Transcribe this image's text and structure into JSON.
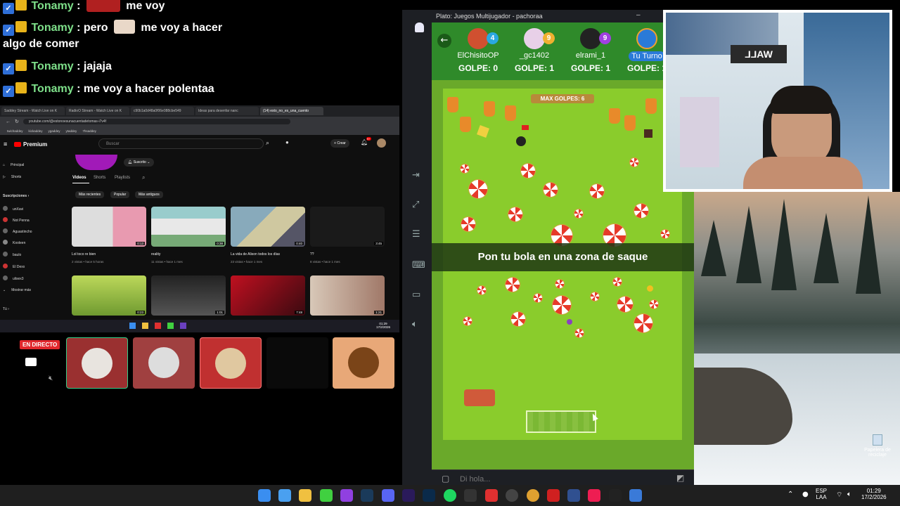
{
  "chat": {
    "lines": [
      {
        "user": "Tonamy",
        "text": "me voy"
      },
      {
        "user": "Tonamy",
        "text": ": pero",
        "text2": "me voy a hacer",
        "cont": "algo de comer"
      },
      {
        "user": "Tonamy",
        "text": ": jajaja"
      },
      {
        "user": "Tonamy",
        "text": ": me voy a hacer polentaa"
      }
    ],
    "colon": ":"
  },
  "browser": {
    "tabs": [
      "Saddey Stream - Watch Live on K",
      "RadioO Stream - Watch Live on K",
      "c90b1a0d48a0f06e088cbe549",
      "Ideas para desenfar nanc",
      "(14) esto_no_es_una_cuento"
    ],
    "url": "youtube.com/@estonoesunacuentadetomas-i7v4f",
    "bookmarks": [
      "twichaddey",
      "kickaddey",
      "ygaddey",
      "ytaddey",
      "7hsaddey"
    ],
    "yt": {
      "logo": "Premium",
      "search_placeholder": "Buscar",
      "create": "Crear",
      "notif_count": "9+",
      "subscribed": "Suscrito",
      "sidebar": [
        "Principal",
        "Shorts"
      ],
      "subs_title": "Suscripciones",
      "subs": [
        "unXavi",
        "Not Penna",
        "Aguastincho",
        "Kooleen",
        "baulo",
        "El Dexx",
        "ulisex3"
      ],
      "show_more": "Mostrar más",
      "you": "Tú",
      "tabs": [
        "Videos",
        "Shorts",
        "Playlists"
      ],
      "chips": [
        "Más recientes",
        "Popular",
        "Más antiguos"
      ],
      "videos": [
        {
          "title": "Lol toco re bien",
          "meta": "2 vistas • hace 5 horas",
          "dur": "0:13"
        },
        {
          "title": "reality",
          "meta": "11 vistas • hace 1 mes",
          "dur": "0:38"
        },
        {
          "title": "La vida de Alison todos los días",
          "meta": "23 vistas • hace 1 mes",
          "dur": "0:40"
        },
        {
          "title": "??",
          "meta": "8 vistas • hace 1 mes",
          "dur": "3:45"
        },
        {
          "title": "",
          "meta": "",
          "dur": "0:23"
        },
        {
          "title": "",
          "meta": "",
          "dur": "1:01"
        },
        {
          "title": "",
          "meta": "",
          "dur": "7:48"
        },
        {
          "title": "",
          "meta": "",
          "dur": "1:21"
        }
      ]
    },
    "inner_clock": {
      "time": "01:29",
      "date": "17/2/2026"
    }
  },
  "streamrow": {
    "live_label": "EN DIRECTO"
  },
  "game": {
    "window_title": "Plato: Juegos Multijugador - pachoraa",
    "players": [
      {
        "name": "ElChisitoOP",
        "num": "4",
        "hits": "GOLPE: 0",
        "color": "#2aa8e0"
      },
      {
        "name": "_gc1402",
        "num": "9",
        "hits": "GOLPE: 1",
        "color": "#f0b030"
      },
      {
        "name": "elrami_1",
        "num": "9",
        "hits": "GOLPE: 1",
        "color": "#a040e0"
      },
      {
        "name": "Tu Turno",
        "num": "",
        "hits": "GOLPE: 1",
        "color": "#2a7ad8"
      }
    ],
    "max_hits": "MAX GOLPES: 6",
    "banner": "Pon tu bola en una zona de saque",
    "chat_placeholder": "Di hola..."
  },
  "desktop": {
    "recycle_label": "Papelera de reciclaje"
  },
  "taskbar": {
    "lang": "ESP",
    "lang2": "LAA",
    "time": "01:29",
    "date": "17/2/2026"
  }
}
